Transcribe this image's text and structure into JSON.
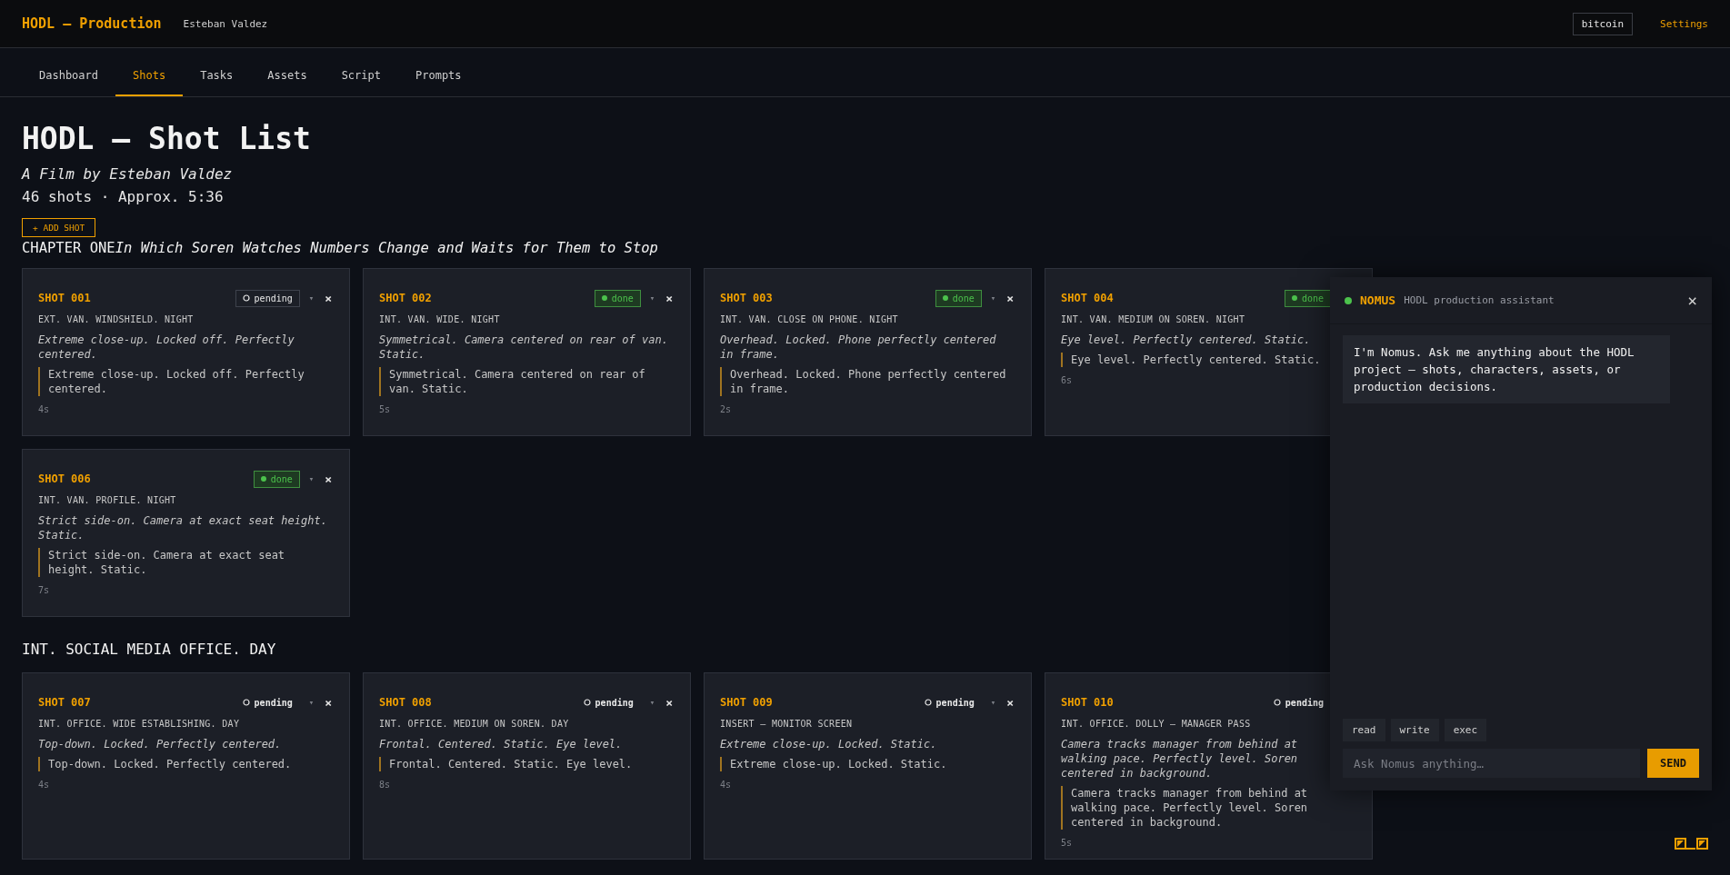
{
  "app": {
    "title": "HODL — Production",
    "user": "Esteban Valdez",
    "project": "bitcoin",
    "settings": "Settings"
  },
  "tabs": [
    {
      "label": "Dashboard",
      "selected": false
    },
    {
      "label": "Shots",
      "selected": true
    },
    {
      "label": "Tasks",
      "selected": false
    },
    {
      "label": "Assets",
      "selected": false
    },
    {
      "label": "Script",
      "selected": false
    },
    {
      "label": "Prompts",
      "selected": false
    }
  ],
  "page": {
    "title": "HODL — Shot List",
    "subtitle": "A Film by Esteban Valdez",
    "summary": "46 shots · Approx. 5:36",
    "add_button": "+ ADD SHOT"
  },
  "sections": [
    {
      "kind": "chapter",
      "heading": "CHAPTER ONE",
      "tagline": "In Which Soren Watches Numbers Change and Waits for Them to Stop",
      "rows": [
        [
          {
            "shot": "SHOT 001",
            "status": {
              "kind": "pending",
              "label": "pending",
              "outlined": true
            },
            "menu": "▾",
            "close": "×",
            "scene": "EXT. VAN. WINDSHIELD. NIGHT",
            "direction": "Extreme close-up. Locked off. Perfectly centered.",
            "note": "Extreme close-up. Locked off. Perfectly centered.",
            "duration": "4s"
          },
          {
            "shot": "SHOT 002",
            "status": {
              "kind": "done",
              "label": "done",
              "outlined": true
            },
            "menu": "▾",
            "close": "×",
            "scene": "INT. VAN. WIDE. NIGHT",
            "direction": "Symmetrical. Camera centered on rear of van. Static.",
            "note": "Symmetrical. Camera centered on rear of van. Static.",
            "duration": "5s"
          },
          {
            "shot": "SHOT 003",
            "status": {
              "kind": "done",
              "label": "done",
              "outlined": true
            },
            "menu": "▾",
            "close": "×",
            "scene": "INT. VAN. CLOSE ON PHONE. NIGHT",
            "direction": "Overhead. Locked. Phone perfectly centered in frame.",
            "note": "Overhead. Locked. Phone perfectly centered in frame.",
            "duration": "2s"
          },
          {
            "shot": "SHOT 004",
            "status": {
              "kind": "done",
              "label": "done",
              "outlined": true
            },
            "scene": "INT. VAN. MEDIUM ON SOREN. NIGHT",
            "direction": "Eye level. Perfectly centered. Static.",
            "note": "Eye level. Perfectly centered. Static.",
            "duration": "6s"
          }
        ],
        [
          {
            "shot": "SHOT 006",
            "status": {
              "kind": "done",
              "label": "done",
              "outlined": true
            },
            "menu": "▾",
            "close": "×",
            "scene": "INT. VAN. PROFILE. NIGHT",
            "direction": "Strict side-on. Camera at exact seat height. Static.",
            "note": "Strict side-on. Camera at exact seat height. Static.",
            "duration": "7s"
          }
        ]
      ]
    },
    {
      "kind": "scene",
      "heading": "INT. SOCIAL MEDIA OFFICE. DAY",
      "rows": [
        [
          {
            "shot": "SHOT 007",
            "status": {
              "kind": "pending",
              "label": "pending",
              "outlined": false
            },
            "menu": "▾",
            "close": "×",
            "scene": "INT. OFFICE. WIDE ESTABLISHING. DAY",
            "direction": "Top-down. Locked. Perfectly centered.",
            "note": "Top-down. Locked. Perfectly centered.",
            "duration": "4s"
          },
          {
            "shot": "SHOT 008",
            "status": {
              "kind": "pending",
              "label": "pending",
              "outlined": false
            },
            "menu": "▾",
            "close": "×",
            "scene": "INT. OFFICE. MEDIUM ON SOREN. DAY",
            "direction": "Frontal. Centered. Static. Eye level.",
            "note": "Frontal. Centered. Static. Eye level.",
            "duration": "8s"
          },
          {
            "shot": "SHOT 009",
            "status": {
              "kind": "pending",
              "label": "pending",
              "outlined": false
            },
            "menu": "▾",
            "close": "×",
            "scene": "INSERT — MONITOR SCREEN",
            "direction": "Extreme close-up. Locked. Static.",
            "note": "Extreme close-up. Locked. Static.",
            "duration": "4s"
          },
          {
            "shot": "SHOT 010",
            "status": {
              "kind": "pending",
              "label": "pending",
              "outlined": false
            },
            "scene": "INT. OFFICE. DOLLY — MANAGER PASS",
            "direction": "Camera tracks manager from behind at walking pace. Perfectly level. Soren centered in background.",
            "note": "Camera tracks manager from behind at walking pace. Perfectly level. Soren centered in background.",
            "duration": "5s"
          }
        ]
      ]
    }
  ],
  "assistant": {
    "name": "NOMUS",
    "online": true,
    "subtitle": "HODL production assistant",
    "close": "×",
    "messages": [
      {
        "text": "I'm Nomus. Ask me anything about the HODL project — shots, characters, assets, or production decisions."
      }
    ],
    "tools": [
      "read",
      "write",
      "exec"
    ],
    "input": {
      "placeholder": "Ask Nomus anything…"
    },
    "send": "SEND"
  }
}
